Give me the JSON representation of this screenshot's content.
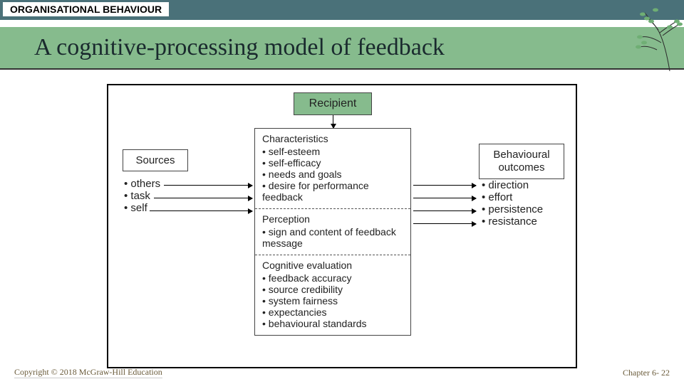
{
  "header": {
    "label": "ORGANISATIONAL BEHAVIOUR"
  },
  "title": "A cognitive-processing model of feedback",
  "diagram": {
    "recipient_label": "Recipient",
    "sources": {
      "label": "Sources",
      "items": [
        "others",
        "task",
        "self"
      ]
    },
    "middle": {
      "characteristics": {
        "title": "Characteristics",
        "items": [
          "self-esteem",
          "self-efficacy",
          "needs and goals",
          "desire for performance feedback"
        ]
      },
      "perception": {
        "title": "Perception",
        "items": [
          "sign and content of feedback message"
        ]
      },
      "cognitive": {
        "title": "Cognitive evaluation",
        "items": [
          "feedback accuracy",
          "source credibility",
          "system fairness",
          "expectancies",
          "behavioural standards"
        ]
      }
    },
    "outcomes": {
      "label": "Behavioural outcomes",
      "items": [
        "direction",
        "effort",
        "persistence",
        "resistance"
      ]
    }
  },
  "footer": {
    "copyright": "Copyright © 2018 McGraw-Hill Education",
    "chapter": "Chapter 6- 22"
  }
}
